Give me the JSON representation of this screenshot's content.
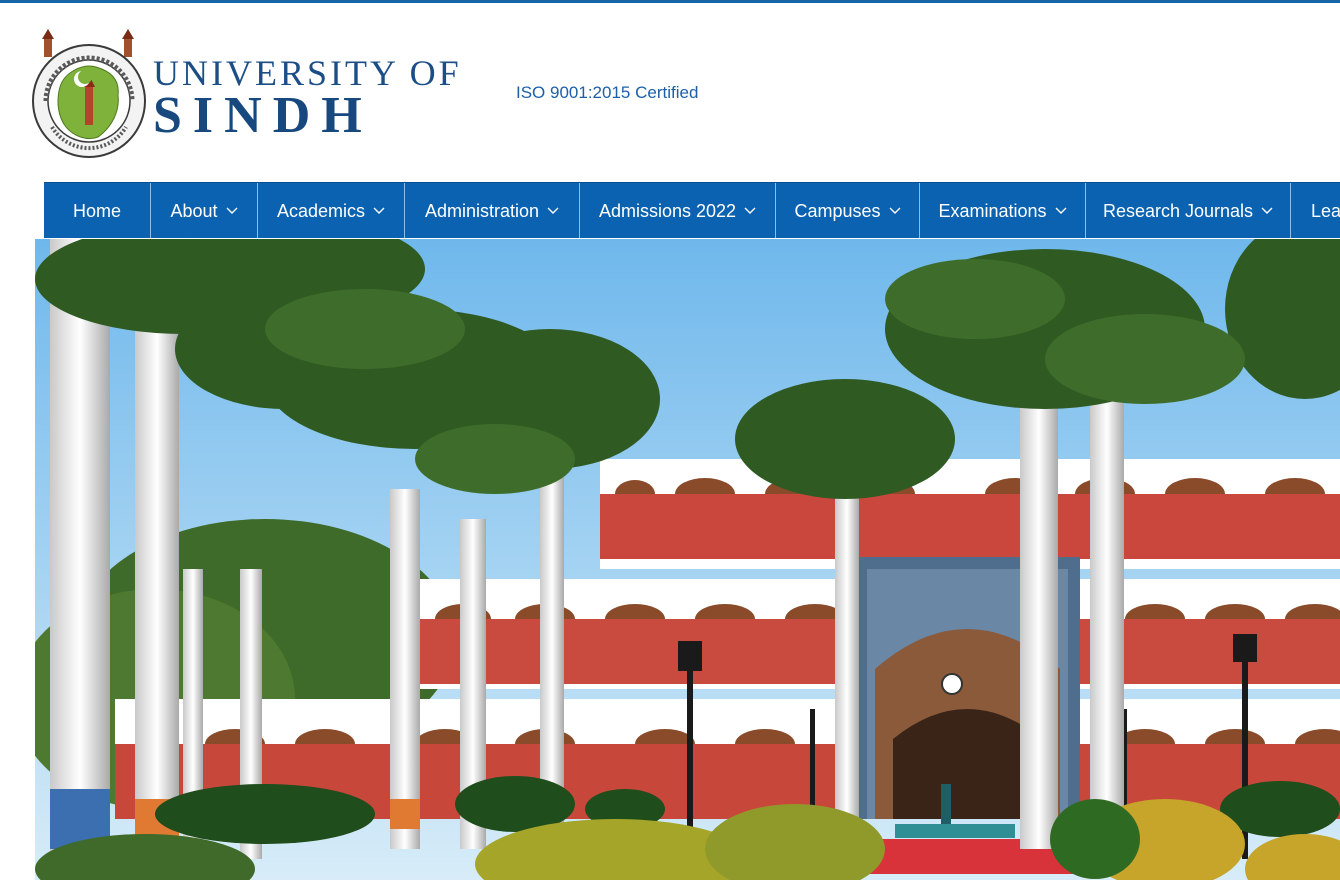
{
  "brand": {
    "name_line1": "UNIVERSITY OF",
    "name_line2": "SINDH",
    "certification": "ISO 9001:2015 Certified",
    "seal_icon": "university-seal-icon",
    "colors": {
      "brand_blue": "#17497f",
      "nav_blue": "#0b62b0",
      "accent_link": "#1c5fa8"
    }
  },
  "nav": {
    "items": [
      {
        "label": "Home",
        "has_dropdown": false
      },
      {
        "label": "About",
        "has_dropdown": true
      },
      {
        "label": "Academics",
        "has_dropdown": true
      },
      {
        "label": "Administration",
        "has_dropdown": true
      },
      {
        "label": "Admissions 2022",
        "has_dropdown": true
      },
      {
        "label": "Campuses",
        "has_dropdown": true
      },
      {
        "label": "Examinations",
        "has_dropdown": true
      },
      {
        "label": "Research Journals",
        "has_dropdown": true
      },
      {
        "label": "Lea",
        "has_dropdown": false
      }
    ],
    "dropdown_icon": "chevron-down-icon"
  },
  "hero": {
    "image": "campus-building-photo"
  }
}
